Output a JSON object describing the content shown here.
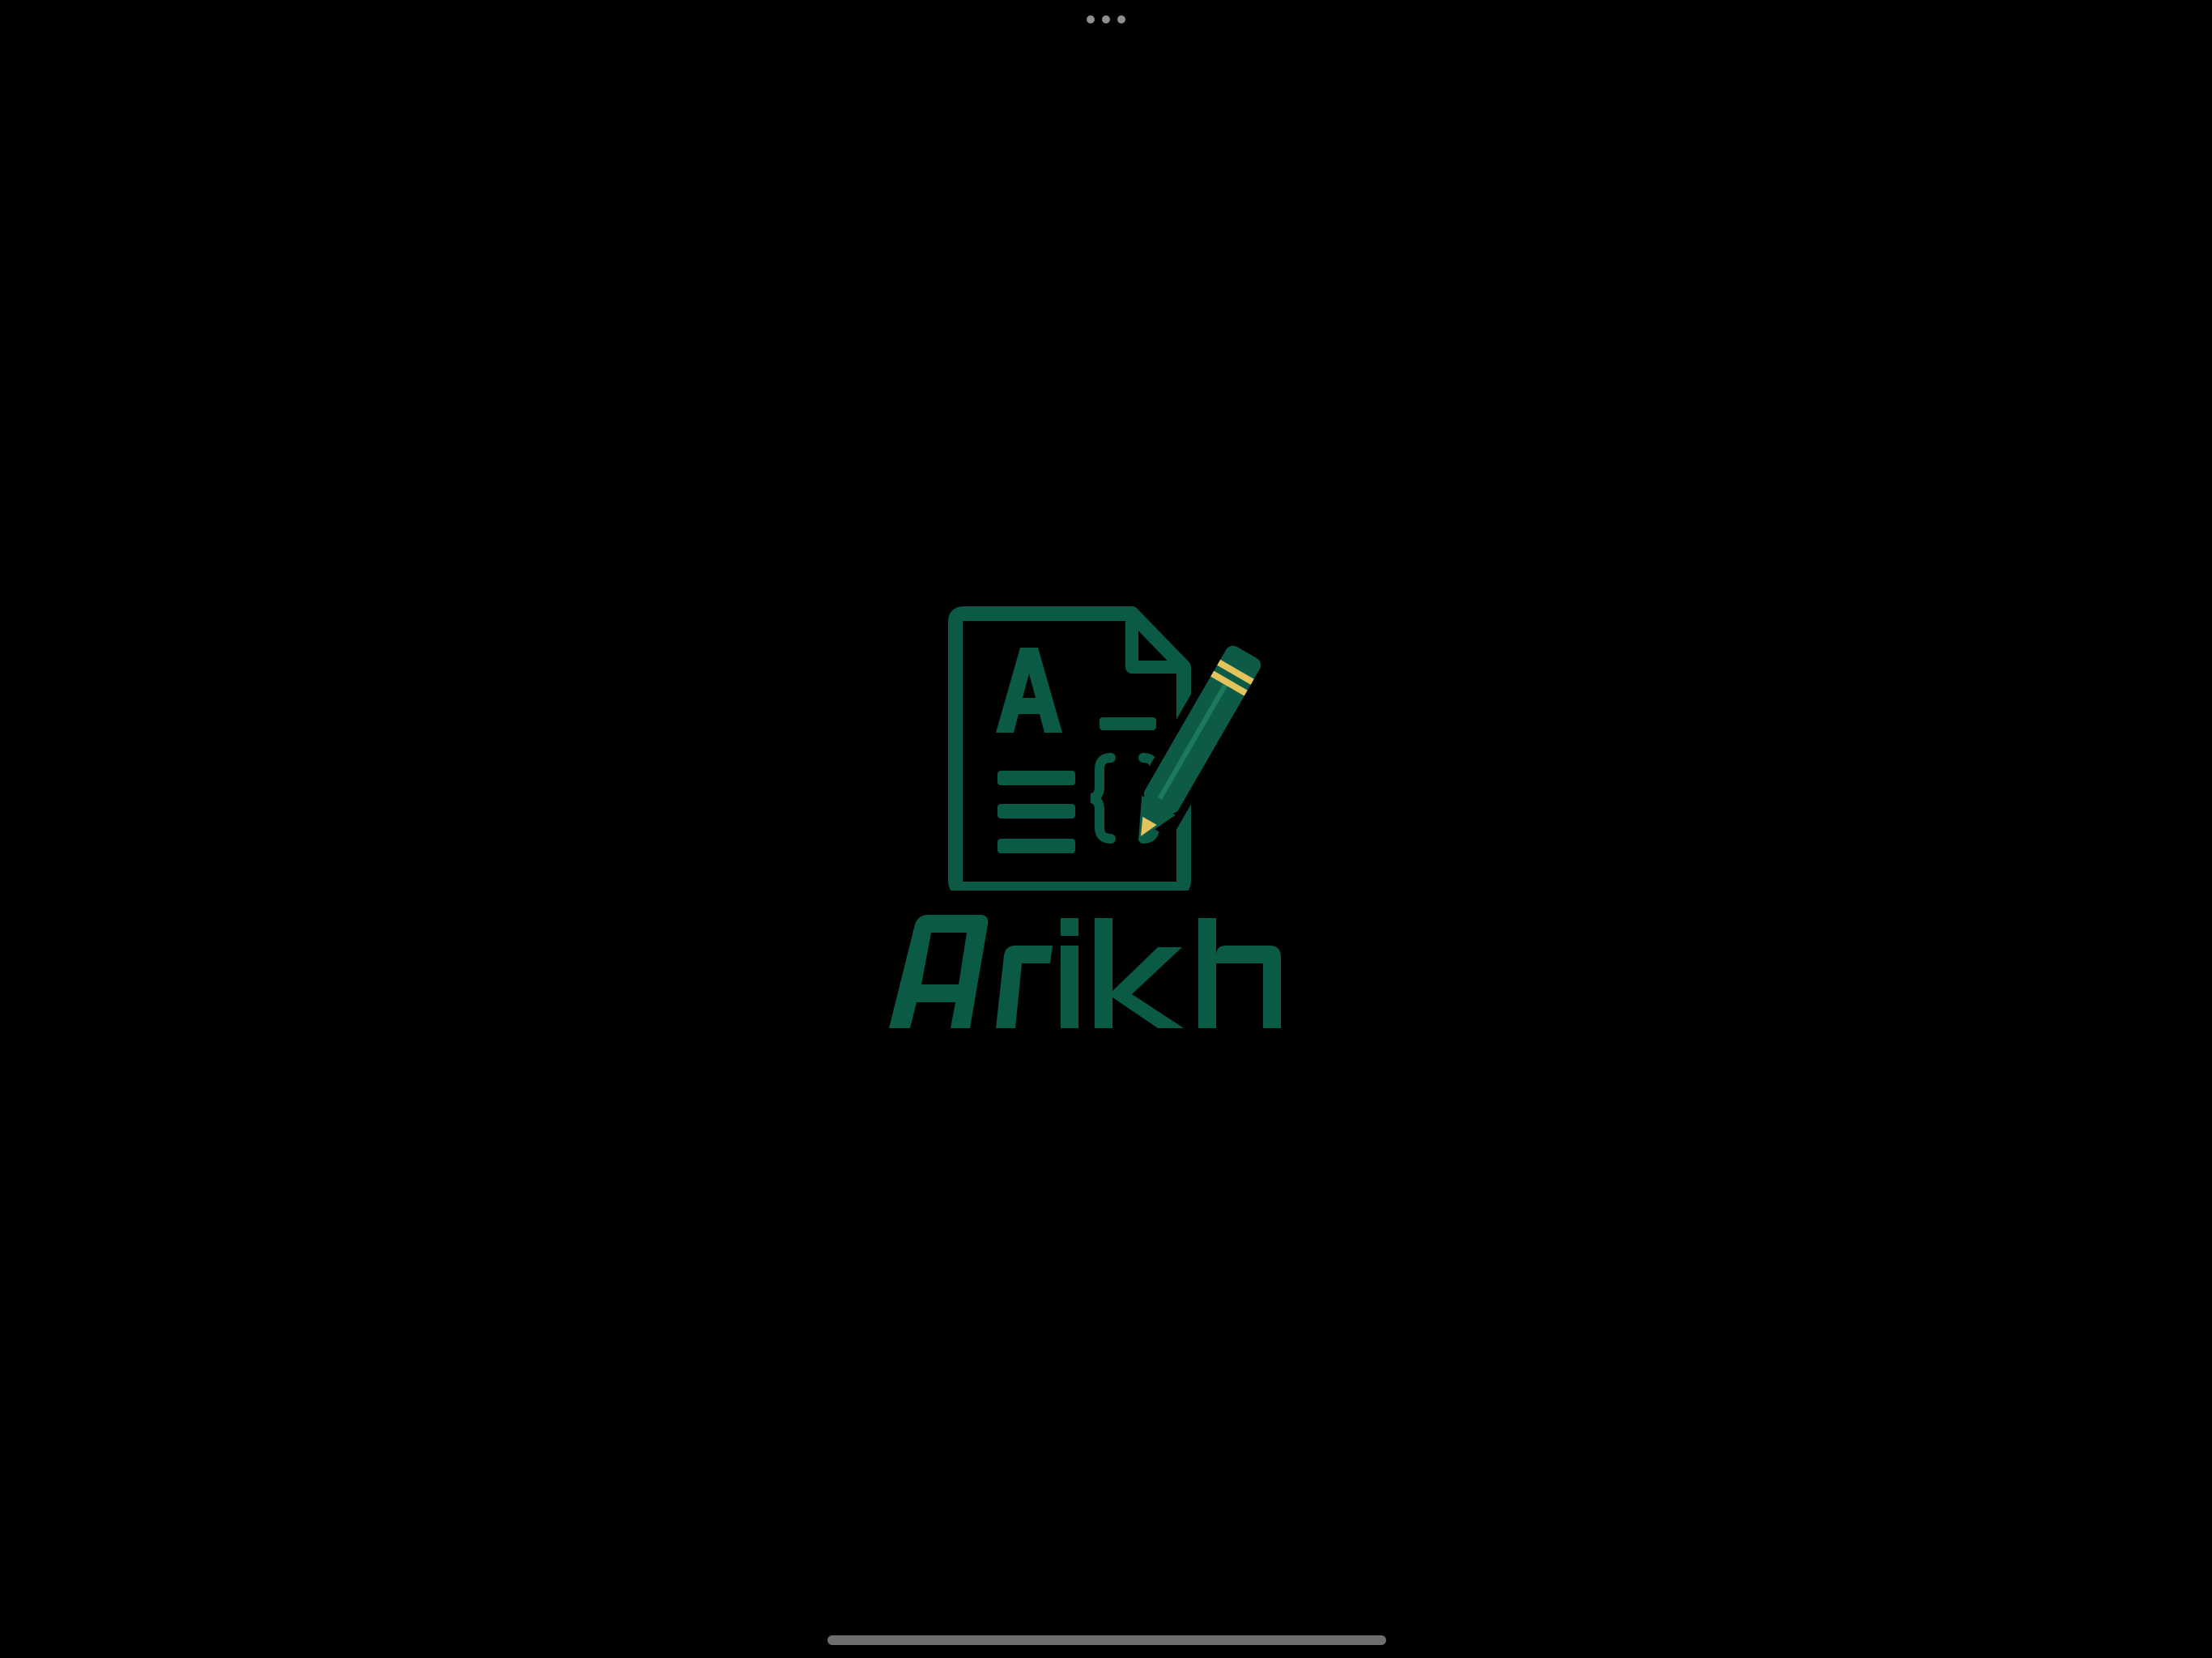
{
  "app": {
    "name": "Arikh",
    "logo_icon": "document-pencil-icon"
  },
  "colors": {
    "background": "#000000",
    "brand_green": "#0b5a45",
    "pencil_green": "#0d5a46",
    "pencil_highlight": "#1c7a5c",
    "accent_gold": "#e3c45c",
    "system_gray": "#8e8e93"
  },
  "system": {
    "multitask_icon": "ellipsis-icon",
    "home_indicator": "home-indicator"
  }
}
